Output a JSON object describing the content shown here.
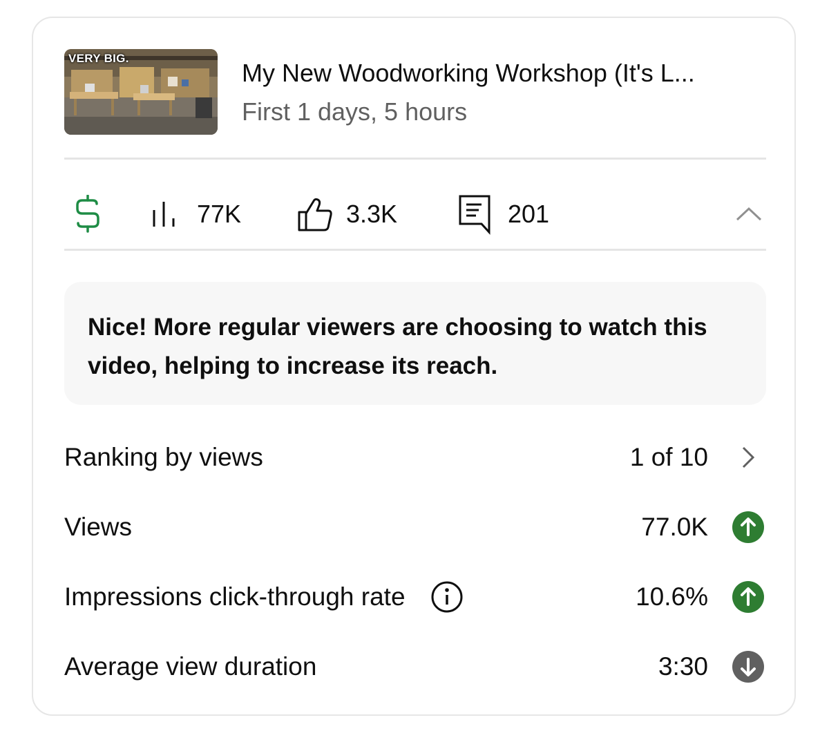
{
  "video": {
    "thumbnail_caption": "VERY BIG.",
    "title": "My New Woodworking Workshop (It's L...",
    "subtitle": "First 1 days, 5 hours"
  },
  "stats": {
    "monetization_icon": "dollar-icon",
    "views_icon": "bar-chart-icon",
    "views": "77K",
    "likes_icon": "thumbs-up-icon",
    "likes": "3.3K",
    "comments_icon": "comment-icon",
    "comments": "201",
    "collapse_icon": "chevron-up-icon"
  },
  "insight": {
    "text": "Nice! More regular viewers are choosing to watch this video, helping to increase its reach."
  },
  "metrics": [
    {
      "label": "Ranking by views",
      "value": "1 of 10",
      "trail_icon": "chevron-right-icon"
    },
    {
      "label": "Views",
      "value": "77.0K",
      "trail_icon": "arrow-up-circle-icon",
      "trend": "up"
    },
    {
      "label": "Impressions click-through rate",
      "value": "10.6%",
      "info_icon": "info-icon",
      "trail_icon": "arrow-up-circle-icon",
      "trend": "up"
    },
    {
      "label": "Average view duration",
      "value": "3:30",
      "trail_icon": "arrow-down-circle-icon",
      "trend": "down"
    }
  ],
  "colors": {
    "money_green": "#1e8c45",
    "trend_up": "#2e7d32",
    "trend_down": "#606060",
    "muted_text": "#606060",
    "insight_bg": "#f7f7f7"
  }
}
